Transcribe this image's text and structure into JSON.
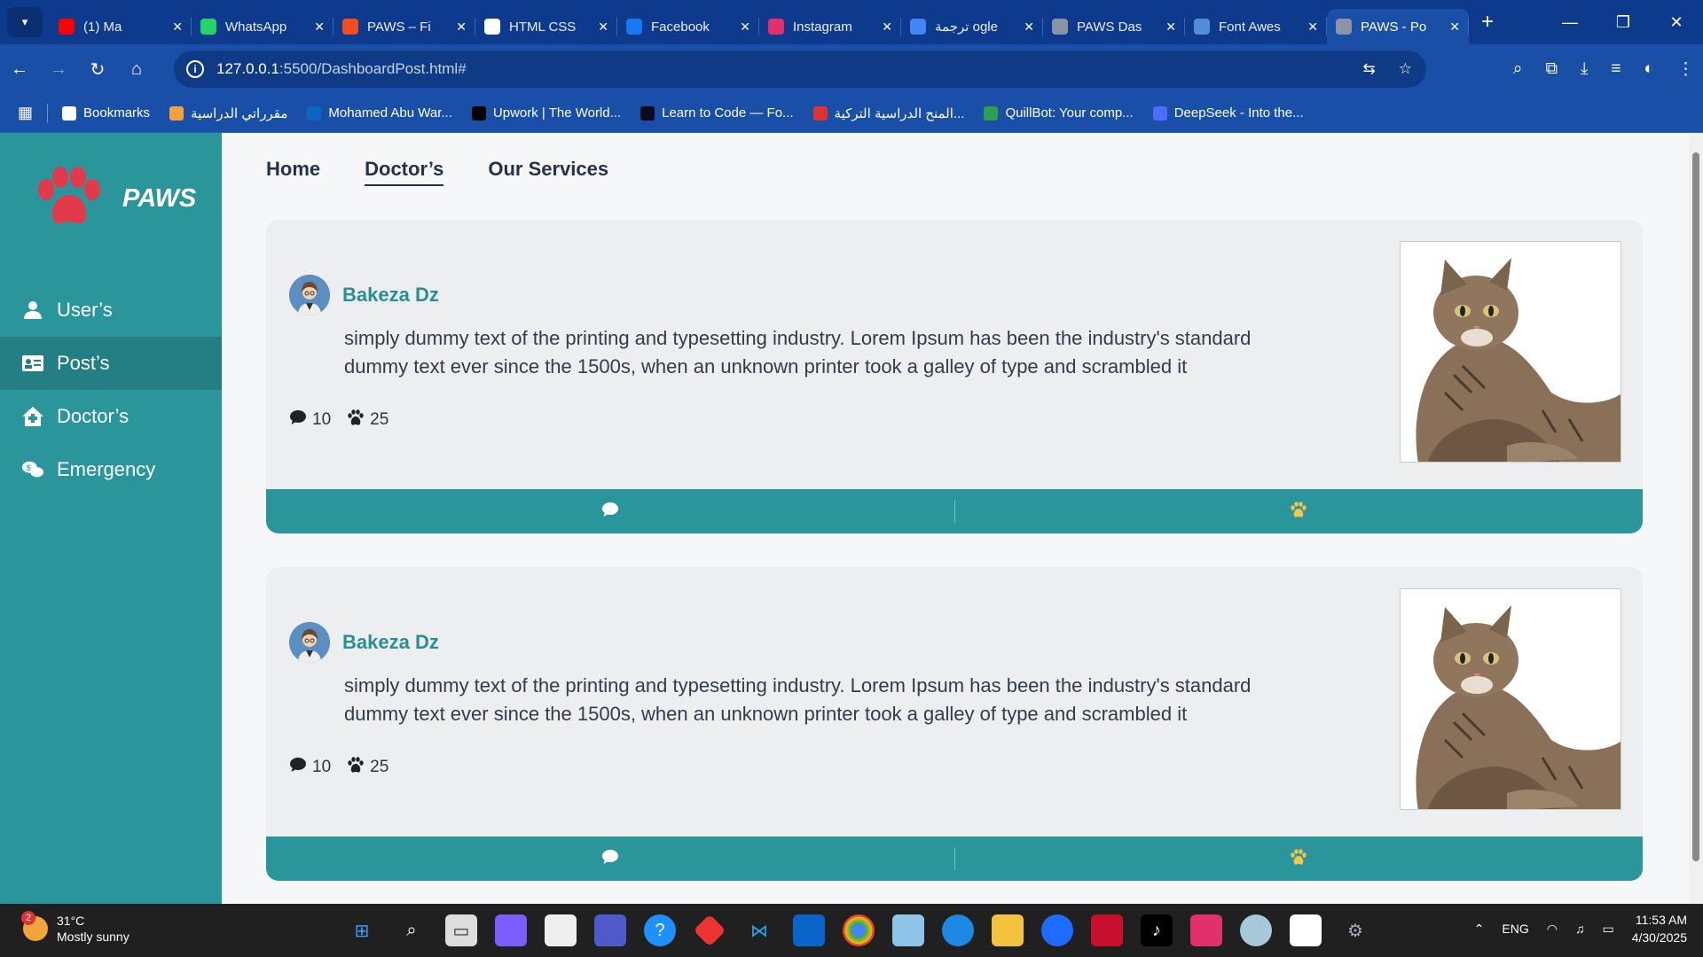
{
  "browser": {
    "tabs": [
      {
        "label": "(1) Ma",
        "favicon_color": "#ff0000",
        "favicon": "youtube-icon"
      },
      {
        "label": "WhatsApp",
        "favicon_color": "#25d366",
        "favicon": "whatsapp-icon"
      },
      {
        "label": "PAWS – Fi",
        "favicon_color": "#f24e1e",
        "favicon": "figma-icon"
      },
      {
        "label": "HTML CSS",
        "favicon_color": "#ffffff",
        "favicon": "openai-icon"
      },
      {
        "label": "Facebook",
        "favicon_color": "#1877f2",
        "favicon": "facebook-icon"
      },
      {
        "label": "Instagram",
        "favicon_color": "#e1306c",
        "favicon": "instagram-icon"
      },
      {
        "label": "ترجمة ogle",
        "favicon_color": "#4285f4",
        "favicon": "translate-icon"
      },
      {
        "label": "PAWS Das",
        "favicon_color": "#8a94a6",
        "favicon": "globe-icon"
      },
      {
        "label": "Font Awes",
        "favicon_color": "#538dd7",
        "favicon": "fontawesome-icon"
      },
      {
        "label": "PAWS - Po",
        "favicon_color": "#8a94a6",
        "favicon": "globe-icon"
      }
    ],
    "new_tab": "+",
    "url_host": "127.0.0.1",
    "url_path": ":5500/DashboardPost.html#",
    "bookmarks": [
      {
        "label": "Bookmarks",
        "color": "#ffffff"
      },
      {
        "label": "مقرراتي الدراسية",
        "color": "#f0a33a"
      },
      {
        "label": "Mohamed Abu War...",
        "color": "#0a66c2"
      },
      {
        "label": "Upwork | The World...",
        "color": "#000000"
      },
      {
        "label": "Learn to Code — Fo...",
        "color": "#0a0a23"
      },
      {
        "label": "المنح الدراسية التركية...",
        "color": "#d33"
      },
      {
        "label": "QuillBot: Your comp...",
        "color": "#2e9e4f"
      },
      {
        "label": "DeepSeek - Into the...",
        "color": "#4d6bfe"
      }
    ]
  },
  "app": {
    "brand": "PAWS",
    "sidebar": [
      {
        "label": "User’s",
        "icon": "user-icon",
        "active": false
      },
      {
        "label": "Post’s",
        "icon": "id-card-icon",
        "active": true
      },
      {
        "label": "Doctor’s",
        "icon": "house-medical-icon",
        "active": false
      },
      {
        "label": "Emergency",
        "icon": "comments-dollar-icon",
        "active": false
      }
    ],
    "topnav": [
      {
        "label": "Home",
        "active": false
      },
      {
        "label": "Doctor’s",
        "active": true
      },
      {
        "label": "Our Services",
        "active": false
      }
    ],
    "posts": [
      {
        "author": "Bakeza Dz",
        "body": "simply dummy text of the printing and typesetting industry. Lorem Ipsum has been the industry's standard dummy text ever since the 1500s, when an unknown printer took a galley of type and scrambled it",
        "comments": "10",
        "paws": "25"
      },
      {
        "author": "Bakeza Dz",
        "body": "simply dummy text of the printing and typesetting industry. Lorem Ipsum has been the industry's standard dummy text ever since the 1500s, when an unknown printer took a galley of type and scrambled it",
        "comments": "10",
        "paws": "25"
      }
    ],
    "colors": {
      "sidebar": "#2a969b",
      "accent_text": "#2a8f95",
      "paw_yellow": "#f4c542",
      "logo_red": "#e23a4a"
    }
  },
  "taskbar": {
    "weather_temp": "31°C",
    "weather_desc": "Mostly sunny",
    "weather_badge": "2",
    "lang": "ENG",
    "time": "11:53 AM",
    "date": "4/30/2025"
  }
}
